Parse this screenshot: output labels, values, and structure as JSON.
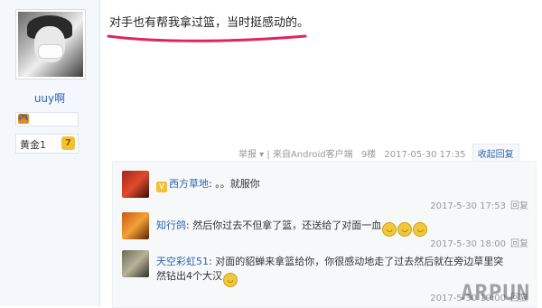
{
  "post": {
    "text": "对手也有帮我拿过篮，当时挺感动的。",
    "meta": {
      "report": "举报 ▾",
      "source": "来自Android客户端",
      "floor": "9楼",
      "time": "2017-05-30 17:35",
      "collapse": "收起回复"
    }
  },
  "user": {
    "name": "uuy啊",
    "level_name": "黄金1",
    "level_num": "7"
  },
  "comments": [
    {
      "name": "西方草地",
      "content": "。。就服你",
      "time": "2017-5-30 17:53",
      "reply": "回复"
    },
    {
      "name": "知行鸽",
      "content": "然后你过去不但拿了篮，还送给了对面一血",
      "time": "2017-5-30 18:00",
      "reply": "回复"
    },
    {
      "name": "天空彩虹51",
      "content_line1": "对面的貂蝉来拿篮给你，你很感动地走了过去然后就在旁边草里突",
      "content_line2": "然钻出4个大汉",
      "time": "2017-5-30 19:00",
      "reply": "回复"
    }
  ],
  "watermark": "ARPUN",
  "colors": {
    "link": "#2d64b3",
    "underline": "#e0245e"
  }
}
